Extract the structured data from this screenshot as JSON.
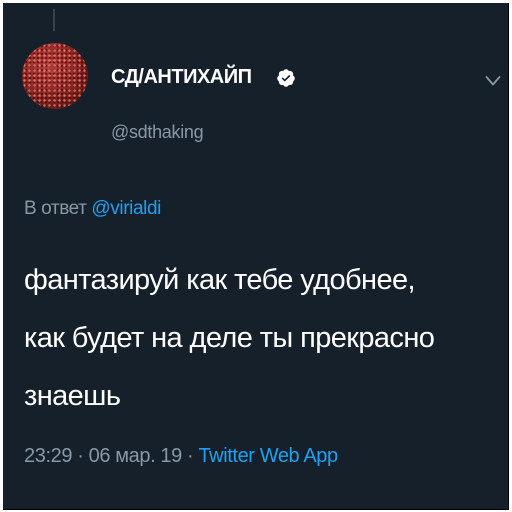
{
  "author": {
    "display_name": "СД/АНТИХАЙП",
    "handle": "@sdthaking",
    "verified": true
  },
  "reply": {
    "prefix": "В ответ",
    "mention": "@virialdi"
  },
  "tweet": {
    "lines": [
      "фантазируй как тебе удобнее,",
      "как будет на деле ты прекрасно",
      "знаешь"
    ]
  },
  "meta": {
    "time": "23:29",
    "separator": "·",
    "date": "06 мар. 19",
    "source": "Twitter Web App"
  },
  "icons": {
    "verified": "verified-badge-icon",
    "more": "chevron-down-icon"
  },
  "colors": {
    "background": "#15202b",
    "secondary_text": "#8899a6",
    "accent": "#1da1f2",
    "primary_text": "#ffffff"
  }
}
